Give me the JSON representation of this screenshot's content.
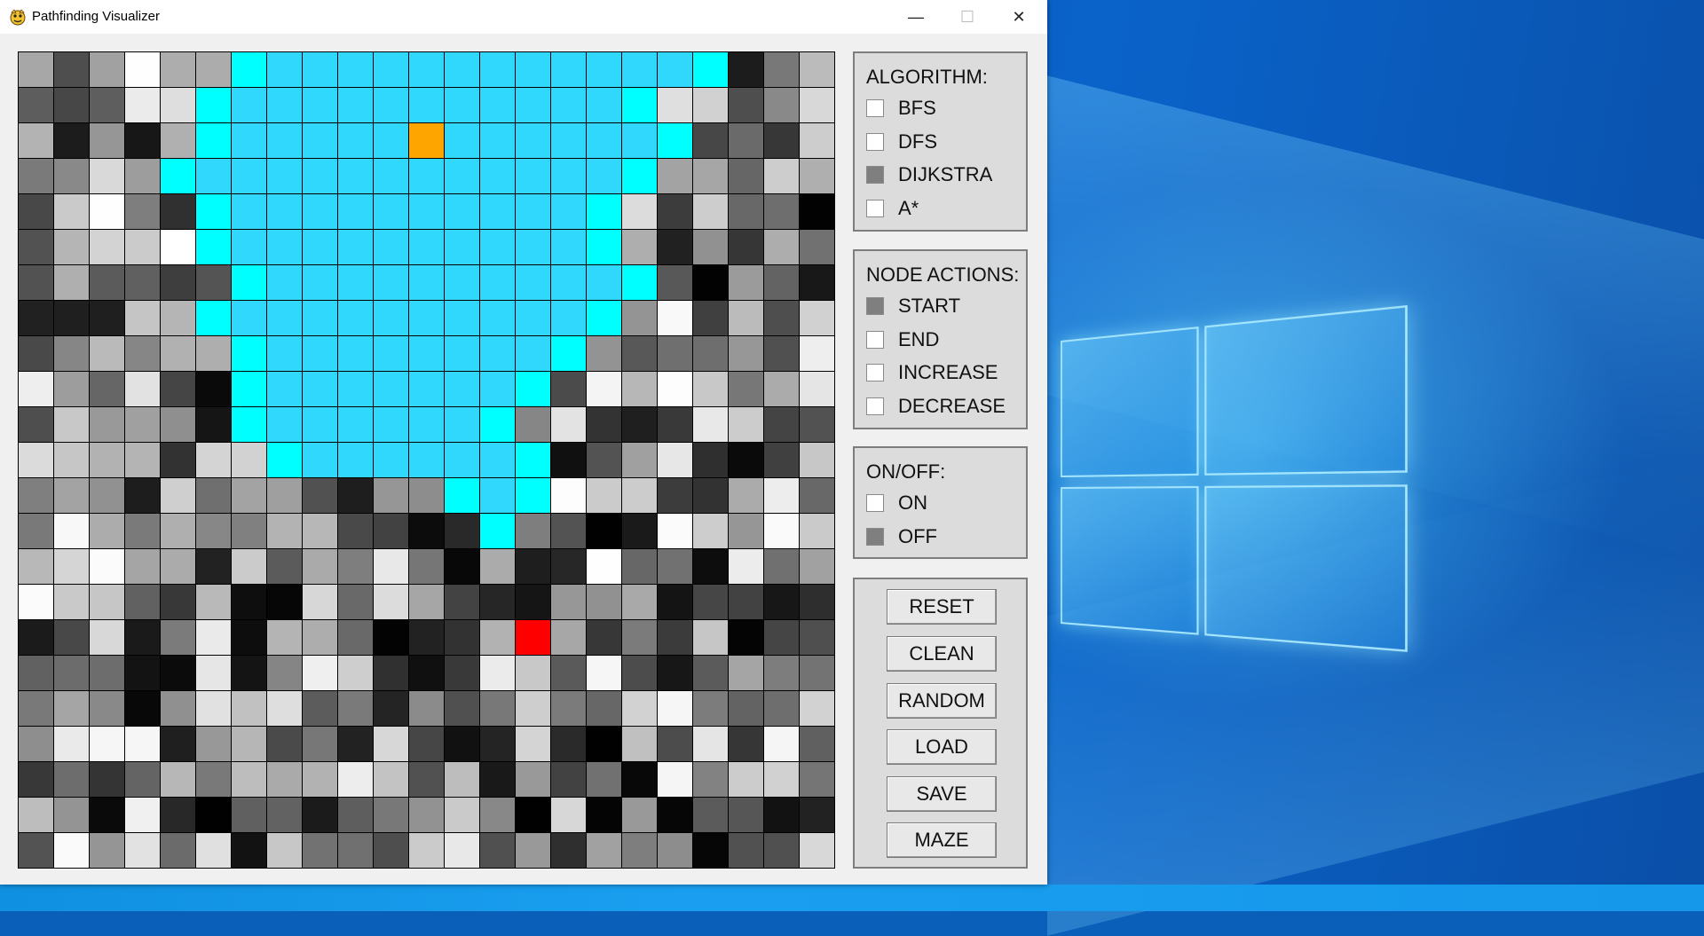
{
  "window": {
    "title": "Pathfinding Visualizer",
    "minimize_glyph": "—",
    "maximize_glyph": "☐",
    "close_glyph": "✕"
  },
  "panels": {
    "algorithm": {
      "title": "ALGORITHM:",
      "options": [
        {
          "label": "BFS",
          "checked": false
        },
        {
          "label": "DFS",
          "checked": false
        },
        {
          "label": "DIJKSTRA",
          "checked": true
        },
        {
          "label": "A*",
          "checked": false
        }
      ]
    },
    "node_actions": {
      "title": "NODE ACTIONS:",
      "options": [
        {
          "label": "START",
          "checked": true
        },
        {
          "label": "END",
          "checked": false
        },
        {
          "label": "INCREASE",
          "checked": false
        },
        {
          "label": "DECREASE",
          "checked": false
        }
      ]
    },
    "onoff": {
      "title": "ON/OFF:",
      "options": [
        {
          "label": "ON",
          "checked": false
        },
        {
          "label": "OFF",
          "checked": true
        }
      ]
    },
    "buttons": [
      "RESET",
      "CLEAN",
      "RANDOM",
      "LOAD",
      "SAVE",
      "MAZE"
    ]
  },
  "grid": {
    "cols": 23,
    "rows": 23,
    "colors": {
      "visited": "#30d8fe",
      "frontier": "#00ffff",
      "start": "#ffa500",
      "end": "#ff0000",
      "border": "#000000"
    },
    "start_cell": [
      11,
      2
    ],
    "end_cell": [
      14,
      16
    ],
    "visited_spans": [
      [
        6,
        19
      ],
      [
        5,
        17
      ],
      [
        5,
        18
      ],
      [
        4,
        17
      ],
      [
        5,
        16
      ],
      [
        5,
        16
      ],
      [
        6,
        17
      ],
      [
        5,
        16
      ],
      [
        6,
        15
      ],
      [
        6,
        14
      ],
      [
        6,
        13
      ],
      [
        7,
        14
      ],
      [
        12,
        14
      ],
      [
        13,
        13
      ]
    ]
  }
}
